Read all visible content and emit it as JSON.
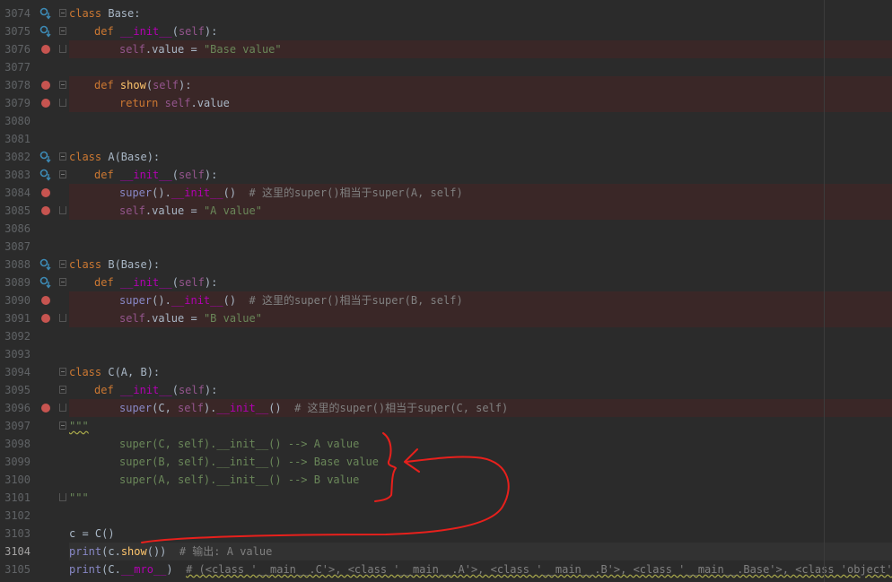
{
  "editor": {
    "current_line": 3104,
    "lines": [
      {
        "num": "3074"
      },
      {
        "num": "3075"
      },
      {
        "num": "3076"
      },
      {
        "num": "3077"
      },
      {
        "num": "3078"
      },
      {
        "num": "3079"
      },
      {
        "num": "3080"
      },
      {
        "num": "3081"
      },
      {
        "num": "3082"
      },
      {
        "num": "3083"
      },
      {
        "num": "3084"
      },
      {
        "num": "3085"
      },
      {
        "num": "3086"
      },
      {
        "num": "3087"
      },
      {
        "num": "3088"
      },
      {
        "num": "3089"
      },
      {
        "num": "3090"
      },
      {
        "num": "3091"
      },
      {
        "num": "3092"
      },
      {
        "num": "3093"
      },
      {
        "num": "3094"
      },
      {
        "num": "3095"
      },
      {
        "num": "3096"
      },
      {
        "num": "3097"
      },
      {
        "num": "3098"
      },
      {
        "num": "3099"
      },
      {
        "num": "3100"
      },
      {
        "num": "3101"
      },
      {
        "num": "3102"
      },
      {
        "num": "3103"
      },
      {
        "num": "3104"
      },
      {
        "num": "3105"
      }
    ],
    "code": {
      "l3074": [
        "class",
        " Base:"
      ],
      "l3075": [
        "def",
        "__init__",
        "self"
      ],
      "l3076": [
        "self",
        ".value = ",
        "\"Base value\""
      ],
      "l3078": [
        "def",
        "show",
        "self"
      ],
      "l3079": [
        "return",
        "self",
        ".value"
      ],
      "l3082": [
        "class",
        " A(Base):"
      ],
      "l3083": [
        "def",
        "__init__",
        "self"
      ],
      "l3084": [
        "super",
        "().",
        "__init__",
        "()  ",
        "# 这里的super()相当于super(A, self)"
      ],
      "l3085": [
        "self",
        ".value = ",
        "\"A value\""
      ],
      "l3088": [
        "class",
        " B(Base):"
      ],
      "l3089": [
        "def",
        "__init__",
        "self"
      ],
      "l3090": [
        "super",
        "().",
        "__init__",
        "()  ",
        "# 这里的super()相当于super(B, self)"
      ],
      "l3091": [
        "self",
        ".value = ",
        "\"B value\""
      ],
      "l3094": [
        "class",
        " C(A, B):"
      ],
      "l3095": [
        "def",
        "__init__",
        "self"
      ],
      "l3096": [
        "super",
        "(C, ",
        "self",
        ").",
        "__init__",
        "()  ",
        "# 这里的super()相当于super(C, self)"
      ],
      "l3097": [
        "\"\"\""
      ],
      "l3098": [
        "super(C, self).__init__() --> A value"
      ],
      "l3099": [
        "super(B, self).__init__() --> Base value"
      ],
      "l3100": [
        "super(A, self).__init__() --> B value"
      ],
      "l3101": [
        "\"\"\""
      ],
      "l3103": [
        "c = C()"
      ],
      "l3104": [
        "print",
        "(c.",
        "show",
        "())  ",
        "# 输出: A value"
      ],
      "l3105": [
        "print",
        "(C.",
        "__mro__",
        ")  ",
        "# (<class '__main__.C'>, <class '__main__.A'>, <class '__main__.B'>, <class '__main__.Base'>, <class 'object'>)"
      ]
    },
    "punct": {
      "open_paren": "(",
      "close_colon": "):"
    }
  },
  "colors": {
    "background": "#2b2b2b",
    "keyword": "#cc7832",
    "function": "#ffc66d",
    "dunder": "#b200b2",
    "self": "#94558d",
    "string": "#6a8759",
    "comment": "#808080",
    "breakpoint": "#c75450",
    "annotation": "#e8201c"
  },
  "icons": {
    "breakpoint": "breakpoint-icon",
    "override": "override-method-icon",
    "fold": "fold-icon"
  }
}
